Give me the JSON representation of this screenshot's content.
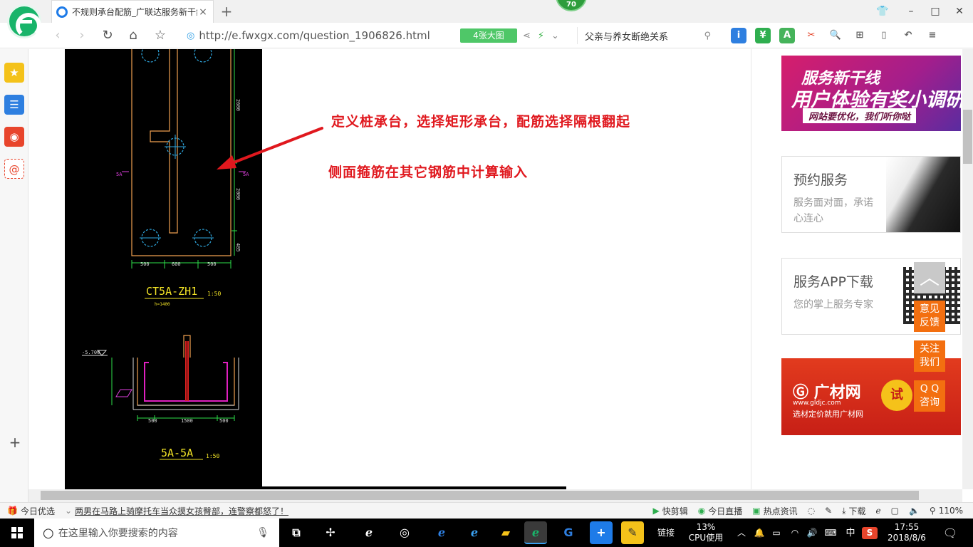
{
  "browser": {
    "tab_title": "不规则承台配筋_广联达服务新干线",
    "tab_close": "×",
    "new_tab": "+",
    "badge": "70",
    "url": "http://e.fwxgx.com/question_1906826.html",
    "big_image_button": "4张大图",
    "search_text": "父亲与养女断绝关系",
    "win_min": "–",
    "win_max": "□",
    "win_close": "✕"
  },
  "cad": {
    "top_label": "CT5A-ZH1",
    "top_scale": "1:50",
    "top_sub": "h=1400",
    "dim_500a": "500",
    "dim_600": "600",
    "dim_500b": "500",
    "sec_mark_l": "5A",
    "sec_mark_r": "5A",
    "vdim_1": "2600",
    "vdim_2": "2000",
    "vdim_3": "485",
    "bot_label": "5A-5A",
    "bot_scale": "1:50",
    "elev": "-5.700",
    "bdim_500a": "500",
    "bdim_1500": "1500",
    "bdim_500b": "500"
  },
  "notes": {
    "line1": "定义桩承台，选择矩形承台，配筋选择隔根翻起",
    "line2": "侧面箍筋在其它钢筋中计算输入"
  },
  "ads": {
    "banner_line1": "服务新干线",
    "banner_line2": "用户体验有奖小调研",
    "banner_line3": "网站要优化，我们听你哒",
    "card1_title": "预约服务",
    "card1_sub": "服务面对面，承诺心连心",
    "card2_title": "服务APP下载",
    "card2_sub": "您的掌上服务专家",
    "gc_name": "广材网",
    "gc_url": "www.gldjc.com",
    "gc_slogan": "选材定价就用广材网",
    "gc_try": "试"
  },
  "float_buttons": {
    "feedback": [
      "意见",
      "反馈"
    ],
    "follow": [
      "关注",
      "我们"
    ],
    "qq": [
      "Q Q",
      "咨询"
    ]
  },
  "statusbar": {
    "today": "今日优选",
    "headline": "两男在马路上骑摩托车当众摸女孩臀部，连警察都怒了！",
    "quick_cut": "快剪辑",
    "live": "今日直播",
    "hot_news": "热点资讯",
    "download": "下载",
    "zoom": "110%"
  },
  "taskbar": {
    "search_placeholder": "在这里输入你要搜索的内容",
    "link": "链接",
    "cpu_pct": "13%",
    "cpu_label": "CPU使用",
    "ime": "中",
    "time": "17:55",
    "date": "2018/8/6"
  },
  "colors": {
    "accent_green": "#19b46a",
    "note_red": "#e0181e",
    "float_orange": "#f36f10"
  }
}
